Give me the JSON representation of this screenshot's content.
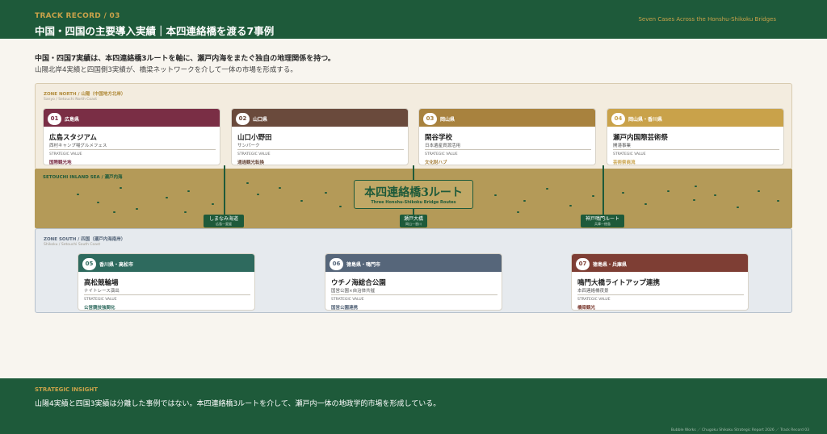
{
  "header": {
    "kicker": "TRACK RECORD / 03",
    "title": "中国・四国の主要導入実績｜本四連絡橋を渡る7事例",
    "right_caption": "Seven Cases Across the Honshu-Shikoku Bridges"
  },
  "lead": {
    "line1": "中国・四国7実績は、本四連絡橋3ルートを軸に、瀬戸内海をまたぐ独自の地理関係を持つ。",
    "line2": "山陽北岸4実績と四国側3実績が、橋梁ネットワークを介して一体の市場を形成する。"
  },
  "zone_north": {
    "label": "ZONE NORTH / 山陽（中国地方北岸）",
    "sub": "Sanyo / Setouchi North Coast"
  },
  "sea": {
    "label": "SETOUCHI INLAND SEA / 瀬戸内海",
    "center_title": "本四連絡橋3ルート",
    "center_sub": "Three Honshu-Shikoku Bridge Routes"
  },
  "zone_south": {
    "label": "ZONE SOUTH / 四国（瀬戸内海南岸）",
    "sub": "Shikoku / Setouchi South Coast"
  },
  "strategic_value_label": "STRATEGIC VALUE",
  "cases": [
    {
      "num": "01",
      "pref": "広島県",
      "name": "広島スタジアム",
      "sub": "西村キャンプ場グルメフェス",
      "value": "国際観光地",
      "color": "#7a2e45"
    },
    {
      "num": "02",
      "pref": "山口県",
      "name": "山口小野田",
      "sub": "サンパーク",
      "value": "通過観光転換",
      "color": "#6a4a3c"
    },
    {
      "num": "03",
      "pref": "岡山県",
      "name": "閑谷学校",
      "sub": "日本遺産資源活用",
      "value": "文化財ハブ",
      "color": "#a8823e"
    },
    {
      "num": "04",
      "pref": "岡山県・香川県",
      "name": "瀬戸内国際芸術祭",
      "sub": "開港事業",
      "value": "芸術祭商流",
      "color": "#c9a24a"
    },
    {
      "num": "05",
      "pref": "香川県・高松市",
      "name": "高松競輪場",
      "sub": "ナイトレース演出",
      "value": "公営競技強関化",
      "color": "#2e6a5e"
    },
    {
      "num": "06",
      "pref": "徳島県・鳴門市",
      "name": "ウチノ海総合公園",
      "sub": "国営公園×自治体共催",
      "value": "国営公園連携",
      "color": "#56667a"
    },
    {
      "num": "07",
      "pref": "徳島県・兵庫県",
      "name": "鳴門大橋ライトアップ連携",
      "sub": "本四連絡橋夜景",
      "value": "橋梁観光",
      "color": "#7e3e34"
    }
  ],
  "routes": [
    {
      "name": "しまなみ海道",
      "sub": "広島—愛媛"
    },
    {
      "name": "瀬戸大橋",
      "sub": "岡山—香川"
    },
    {
      "name": "神戸鳴門ルート",
      "sub": "兵庫—徳島"
    }
  ],
  "footer": {
    "label": "STRATEGIC INSIGHT",
    "text": "山陽4実績と四国3実績は分離した事例ではない。本四連絡橋3ルートを介して、瀬戸内一体の地政学的市場を形成している。",
    "credit": "Bubble Works ／ Chugoku Shikoku Strategic Report 2026 ／ Track Record 03"
  },
  "colors": {
    "brand_green": "#1e5a3a",
    "gold": "#c9a24a",
    "sea": "#b49a58"
  }
}
